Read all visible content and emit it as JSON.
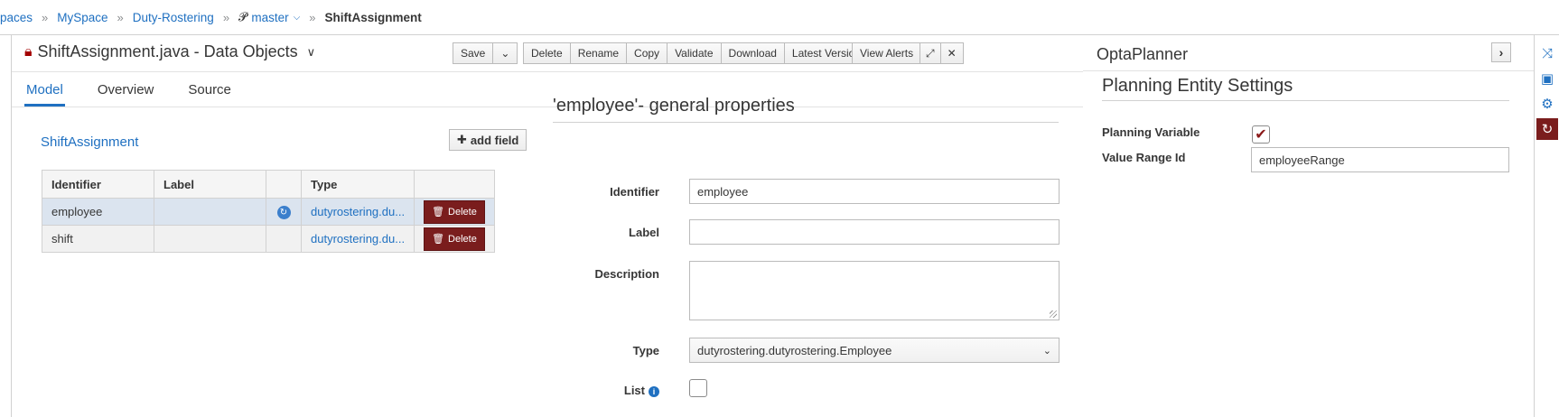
{
  "breadcrumb": {
    "items": [
      "paces",
      "MySpace",
      "Duty-Rostering"
    ],
    "branch": "master",
    "current": "ShiftAssignment",
    "separator": "»"
  },
  "editor": {
    "title": "ShiftAssignment.java - Data Objects",
    "toolbar_group1": [
      "Save"
    ],
    "toolbar_group2": [
      "Delete",
      "Rename",
      "Copy",
      "Validate",
      "Download",
      "Latest Version"
    ],
    "toolbar_group3": [
      "View Alerts"
    ],
    "tabs": [
      "Model",
      "Overview",
      "Source"
    ],
    "active_tab": "Model"
  },
  "model": {
    "object_name": "ShiftAssignment",
    "add_field_label": "add field",
    "columns": [
      "Identifier",
      "Label",
      "",
      "Type",
      ""
    ],
    "rows": [
      {
        "identifier": "employee",
        "label": "",
        "type": "dutyrostering.du...",
        "delete": "Delete"
      },
      {
        "identifier": "shift",
        "label": "",
        "type": "dutyrostering.du...",
        "delete": "Delete"
      }
    ]
  },
  "properties": {
    "title": "'employee'- general properties",
    "identifier_label": "Identifier",
    "identifier_value": "employee",
    "label_label": "Label",
    "label_value": "",
    "description_label": "Description",
    "description_value": "",
    "type_label": "Type",
    "type_value": "dutyrostering.dutyrostering.Employee",
    "list_label": "List"
  },
  "optaplanner": {
    "title": "OptaPlanner",
    "subtitle": "Planning Entity Settings",
    "planning_variable_label": "Planning Variable",
    "planning_variable_checked": true,
    "value_range_label": "Value Range Id",
    "value_range_value": "employeeRange"
  },
  "strip": {
    "icons": [
      "shuffle-icon",
      "briefcase-icon",
      "gear-icon",
      "optaplanner-icon"
    ],
    "active": "optaplanner-icon"
  },
  "colors": {
    "link": "#1f70c1",
    "delete_bg": "#7a1d1d",
    "selected_row": "#dbe4ef"
  }
}
